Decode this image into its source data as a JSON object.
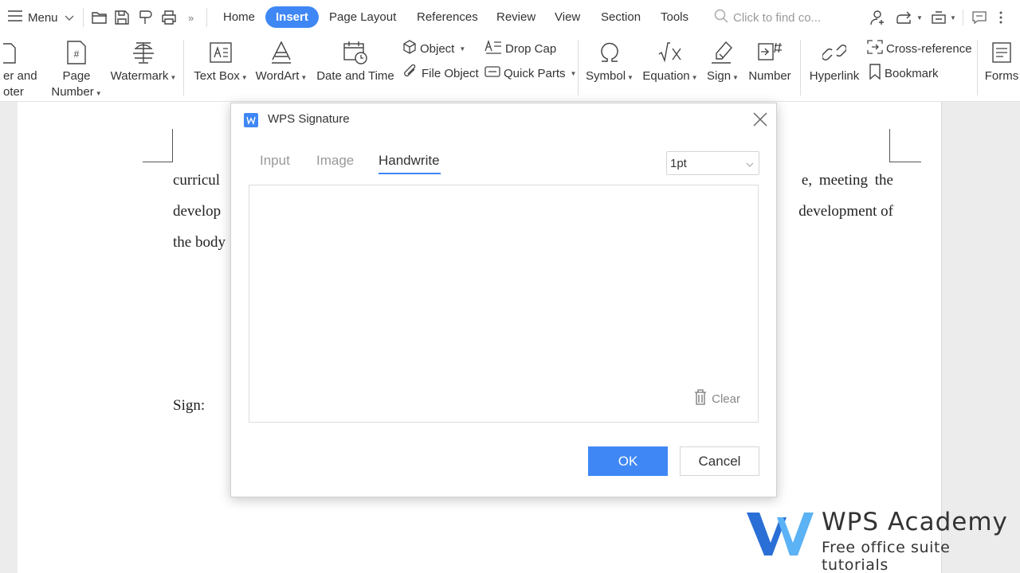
{
  "topbar": {
    "menu_label": "Menu",
    "tabs": [
      {
        "label": "Home"
      },
      {
        "label": "Insert"
      },
      {
        "label": "Page Layout"
      },
      {
        "label": "References"
      },
      {
        "label": "Review"
      },
      {
        "label": "View"
      },
      {
        "label": "Section"
      },
      {
        "label": "Tools"
      }
    ],
    "active_tab": "Insert",
    "search_placeholder": "Click to find co..."
  },
  "ribbon": {
    "header_footer_label_1": "er and",
    "header_footer_label_2": "oter",
    "page_number_label_1": "Page",
    "page_number_label_2": "Number",
    "watermark_label": "Watermark",
    "text_box_label": "Text Box",
    "wordart_label": "WordArt",
    "date_time_label": "Date and Time",
    "object_label": "Object",
    "file_object_label": "File Object",
    "drop_cap_label": "Drop Cap",
    "quick_parts_label": "Quick Parts",
    "symbol_label": "Symbol",
    "equation_label": "Equation",
    "sign_label": "Sign",
    "number_label": "Number",
    "hyperlink_label": "Hyperlink",
    "cross_reference_label": "Cross-reference",
    "bookmark_label": "Bookmark",
    "forms_label": "Forms"
  },
  "document": {
    "lines": [
      {
        "left": "curricul",
        "right": "e,  meeting  the"
      },
      {
        "left": "develop",
        "right": "development of"
      },
      {
        "left": "the body",
        "right": ""
      }
    ],
    "sign_label": "Sign:"
  },
  "dialog": {
    "title": "WPS Signature",
    "tabs": {
      "input": "Input",
      "image": "Image",
      "handwrite": "Handwrite"
    },
    "active_tab": "Handwrite",
    "pen_width": "1pt",
    "clear_label": "Clear",
    "ok_label": "OK",
    "cancel_label": "Cancel"
  },
  "watermark": {
    "title": "WPS Academy",
    "subtitle": "Free office suite tutorials"
  },
  "colors": {
    "accent": "#3f87f5",
    "logo_dark": "#2a6fd6",
    "logo_light": "#5bb2f5"
  }
}
